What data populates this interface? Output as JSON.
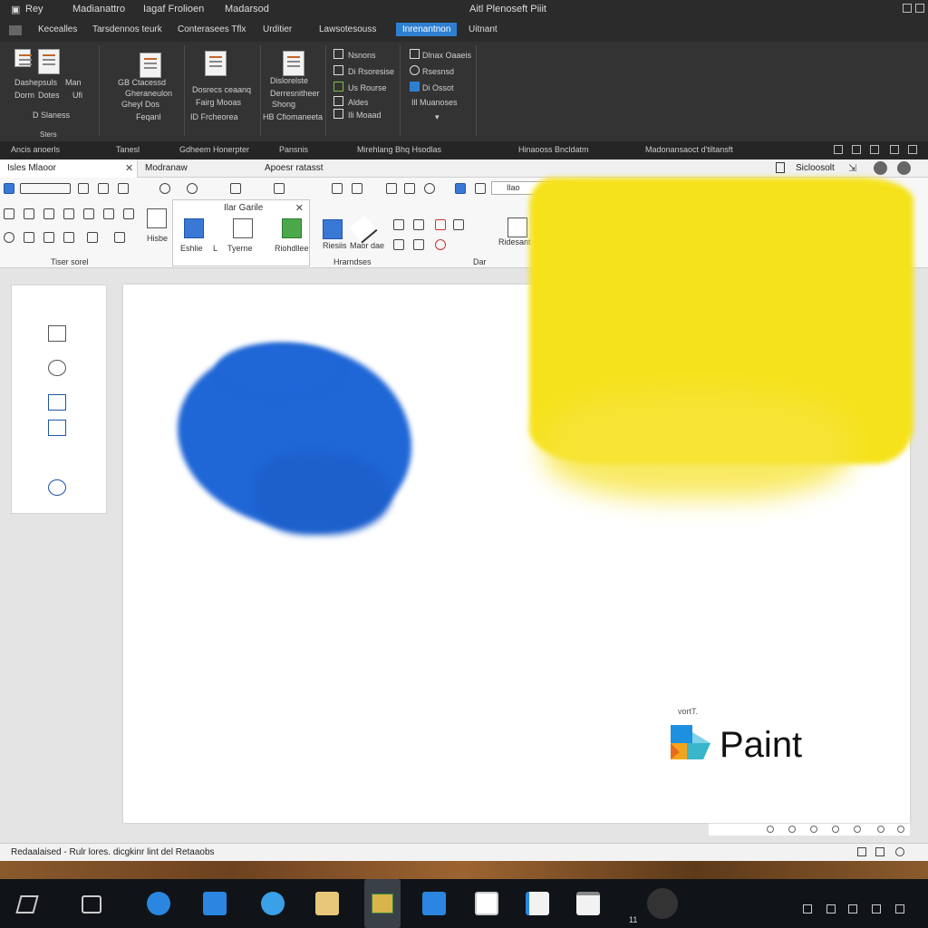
{
  "window": {
    "menu": [
      "Rey",
      "Madianattro",
      "Iagaf Frolioen",
      "Madarsod"
    ],
    "title": "Aitl Plenoseft Piiit"
  },
  "dark_tabs": [
    "Kecealles",
    "Tarsdennos teurk",
    "Conterasees Tflx",
    "Urditier",
    "Lawsotesouss",
    "Inrenantnon",
    "Uitnant"
  ],
  "dark_ribbon": {
    "group1": [
      "Dashepsuls",
      "Dorm",
      "Dotes",
      "Man",
      "Ufi",
      "D Slaness",
      "Sters"
    ],
    "group2": [
      "GB Ctacessd",
      "Gheraneulon",
      "Gheyl Dos",
      "Feqanl"
    ],
    "group3": [
      "Dosrecs ceaanq",
      "Fairg Mooas",
      "ID Frcheorea"
    ],
    "group4": [
      "Dislorelste",
      "Derresnitheer",
      "Shong",
      "HB Cfiomaneeta"
    ],
    "group5": [
      "Nsnons",
      "Di Rsoresise",
      "Us Rourse",
      "Aldes",
      "Ili Moaad"
    ],
    "group6": [
      "Dlnax Oaaeis",
      "Rsesnsd",
      "Di Ossot",
      "Ill Muanoses"
    ]
  },
  "dark_footer": [
    "Ancis anoerls",
    "Tanesl",
    "Gdheem Honerpter",
    "Pansnis",
    "Mirehlang Bhq Hsodlas",
    "Hinaooss Bncldatm",
    "Madonansaoct d'tiltansft"
  ],
  "light_tabs": {
    "tab1": "Isles Mlaoor",
    "tab2": "Modranaw",
    "tab3": "Apoesr ratasst",
    "right": "Sicloosolt"
  },
  "light_ribbon": {
    "popup_title": "Ilar Garile",
    "popup_items": [
      "Eshlie",
      "L",
      "Tyerne",
      "Riohdllee"
    ],
    "shapes_items": [
      "Riesiis",
      "Maor dae"
    ],
    "edit_label": "Ridesant",
    "combo_text": "Ilao",
    "group_labels": [
      "Tiser sorel",
      "Hrarndses",
      "Dar"
    ],
    "note_label": "Hisbe"
  },
  "status": {
    "text": "Redaalaised - Rulr lores. dicgkinr lint del Retaaobs"
  },
  "canvas": {
    "logo_text": "Paint",
    "logo_caption": "vortT."
  },
  "taskbar": {
    "clock": "11"
  },
  "colors": {
    "accent": "#2f7fd1",
    "blue_paint": "#1f66d6",
    "yellow_paint": "#f6e21b"
  }
}
